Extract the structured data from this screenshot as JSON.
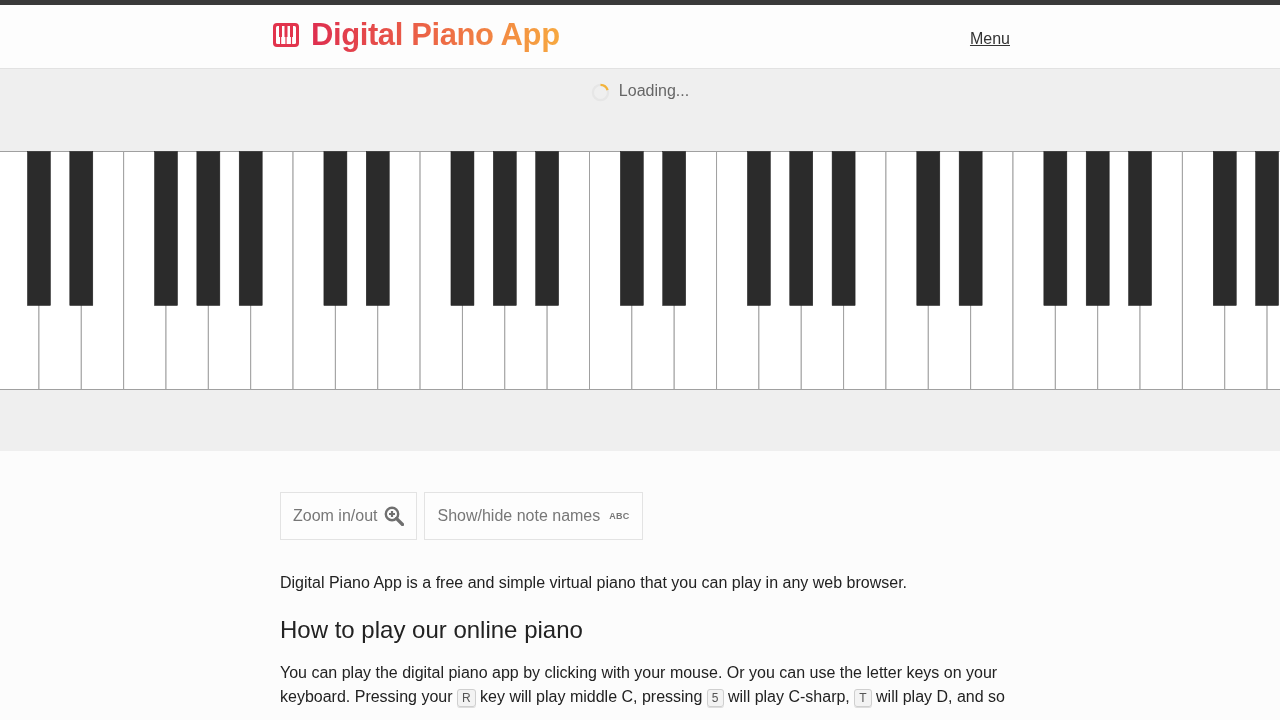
{
  "header": {
    "logo": "Digital Piano App",
    "menu_link": "Menu"
  },
  "status": {
    "loading": true,
    "text": "Loading..."
  },
  "controls": [
    {
      "kind": "zoom",
      "label": "Zoom in/out"
    },
    {
      "kind": "note_names",
      "label": "Show/hide note names",
      "badge": "ABC"
    }
  ],
  "content": [
    {
      "kind": "paragraph",
      "parts": [
        {
          "kind": "text",
          "text": "Digital Piano App is a free and simple virtual piano that you can play in any web browser."
        }
      ]
    },
    {
      "kind": "heading",
      "text": "How to play our online piano"
    },
    {
      "kind": "paragraph",
      "parts": [
        {
          "kind": "text",
          "text": "You can play the digital piano app by clicking with your mouse. Or you can use the letter keys on your keyboard. Pressing your "
        },
        {
          "kind": "key",
          "text": "R"
        },
        {
          "kind": "text",
          "text": " key will play middle C, pressing "
        },
        {
          "kind": "key",
          "text": "5"
        },
        {
          "kind": "text",
          "text": " will play C-sharp, "
        },
        {
          "kind": "key",
          "text": "T"
        },
        {
          "kind": "text",
          "text": " will play D, and so"
        }
      ]
    }
  ]
}
